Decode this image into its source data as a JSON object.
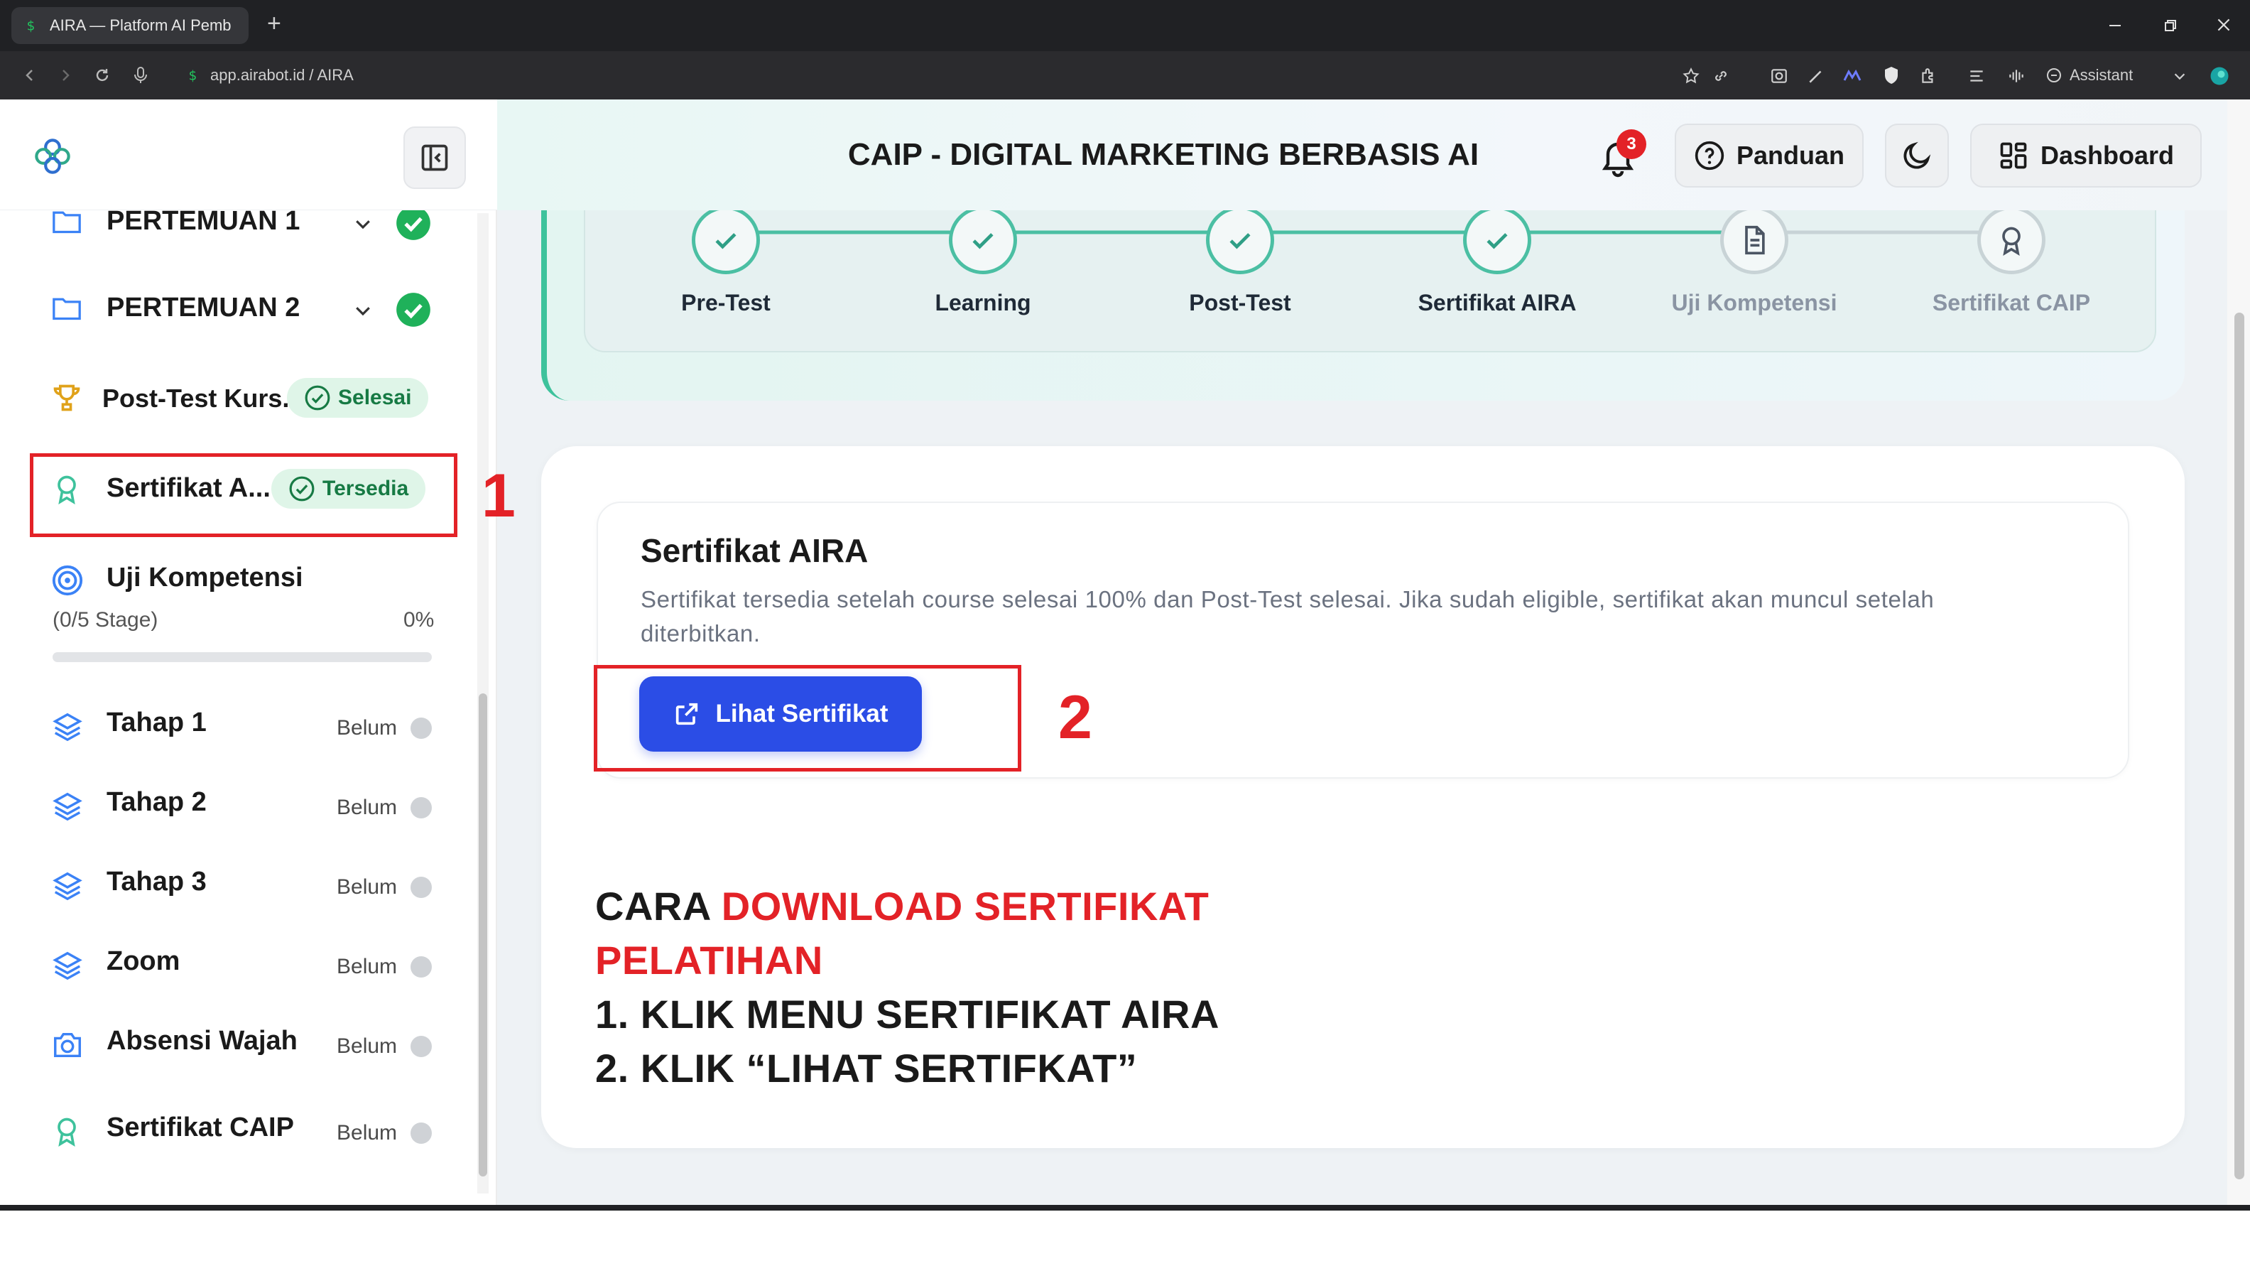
{
  "browser": {
    "tab_title": "AIRA — Platform AI Pemb",
    "new_tab": "+",
    "url": "app.airabot.id / AIRA",
    "assistant": "Assistant"
  },
  "header": {
    "title": "CAIP - DIGITAL MARKETING BERBASIS AI",
    "notification_count": "3",
    "guide_label": "Panduan",
    "dashboard_label": "Dashboard"
  },
  "sidebar": {
    "pertemuan1": "PERTEMUAN 1",
    "pertemuan2": "PERTEMUAN 2",
    "posttest_label": "Post-Test Kurs...",
    "posttest_status": "Selesai",
    "sertifikat_label": "Sertifikat A...",
    "sertifikat_status": "Tersedia",
    "uji_label": "Uji Kompetensi",
    "uji_stage": "(0/5 Stage)",
    "uji_percent": "0%",
    "uji_progress": 0,
    "items": [
      {
        "label": "Tahap 1",
        "status": "Belum"
      },
      {
        "label": "Tahap 2",
        "status": "Belum"
      },
      {
        "label": "Tahap 3",
        "status": "Belum"
      },
      {
        "label": "Zoom",
        "status": "Belum"
      },
      {
        "label": "Absensi Wajah",
        "status": "Belum"
      },
      {
        "label": "Sertifikat CAIP",
        "status": "Belum"
      }
    ]
  },
  "steps": [
    {
      "label": "Pre-Test",
      "state": "done"
    },
    {
      "label": "Learning",
      "state": "done"
    },
    {
      "label": "Post-Test",
      "state": "done"
    },
    {
      "label": "Sertifikat AIRA",
      "state": "done"
    },
    {
      "label": "Uji Kompetensi",
      "state": "pending"
    },
    {
      "label": "Sertifikat CAIP",
      "state": "pending"
    }
  ],
  "certificate": {
    "title": "Sertifikat AIRA",
    "description_line1": "Sertifikat tersedia setelah course selesai 100% dan Post-Test selesai. Jika sudah eligible, sertifikat akan muncul setelah",
    "description_line2": "diterbitkan.",
    "button_label": "Lihat Sertifikat"
  },
  "annotations": {
    "marker1": "1",
    "marker2": "2",
    "line1_black": "CARA ",
    "line1_red": "DOWNLOAD SERTIFIKAT",
    "line2_red": "PELATIHAN",
    "line3": "1. KLIK MENU SERTIFIKAT AIRA",
    "line4": "2. KLIK “LIHAT SERTIFKAT”"
  },
  "colors": {
    "accent_green": "#1fb15a",
    "step_teal": "#4bbfa3",
    "primary_blue": "#2b4de6",
    "annotation_red": "#e32227"
  }
}
